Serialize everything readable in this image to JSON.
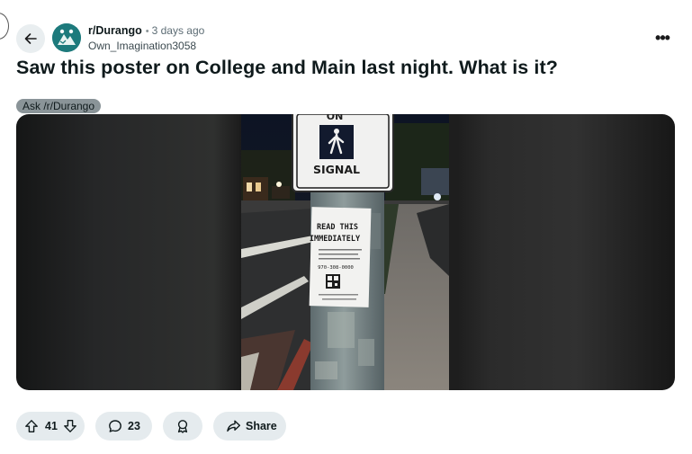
{
  "post": {
    "subreddit": "r/Durango",
    "separator": "•",
    "time": "3 days ago",
    "username": "Own_Imagination3058",
    "more": "•••",
    "title": "Saw this poster on College and Main last night. What is it?",
    "flair": "Ask /r/Durango"
  },
  "image": {
    "sign_top": "ON",
    "sign_bottom": "SIGNAL",
    "poster_line1": "READ THIS",
    "poster_line2": "IMMEDIATELY",
    "poster_phone": "970-308-0000"
  },
  "actions": {
    "vote_count": "41",
    "comment_count": "23",
    "share_label": "Share"
  },
  "icons": [
    "back-arrow-icon",
    "subreddit-avatar-icon",
    "more-options-icon",
    "upvote-icon",
    "downvote-icon",
    "comment-icon",
    "award-icon",
    "share-icon"
  ]
}
